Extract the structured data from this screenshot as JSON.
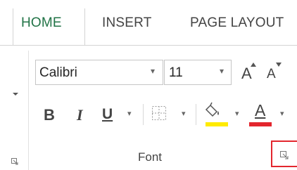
{
  "tabs": [
    {
      "label": "HOME",
      "active": true
    },
    {
      "label": "INSERT",
      "active": false
    },
    {
      "label": "PAGE LAYOUT",
      "active": false
    }
  ],
  "font_group": {
    "label": "Font",
    "font_name": {
      "value": "Calibri"
    },
    "font_size": {
      "value": "11"
    },
    "grow_font_label": "A",
    "shrink_font_label": "A",
    "bold_label": "B",
    "italic_label": "I",
    "underline_label": "U",
    "font_color_label": "A",
    "highlight_color": "#ffeb00",
    "font_color": "#e3262e",
    "launcher_highlighted": true
  },
  "colors": {
    "active_tab": "#217346",
    "highlight_border": "#e3262e"
  },
  "icons": [
    "chevron-down-icon",
    "borders-icon",
    "fill-bucket-icon",
    "dialog-launcher-icon"
  ]
}
